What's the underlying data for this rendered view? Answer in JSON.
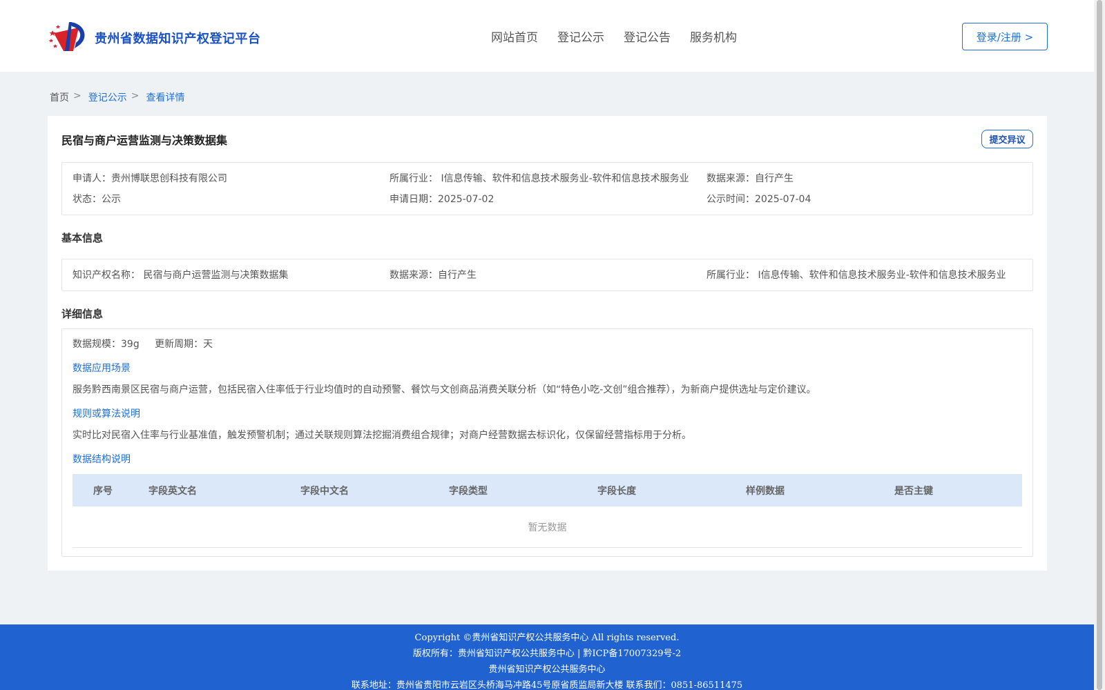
{
  "header": {
    "site_title": "贵州省数据知识产权登记平台",
    "nav": [
      "网站首页",
      "登记公示",
      "登记公告",
      "服务机构"
    ],
    "login_label": "登录/注册 >"
  },
  "breadcrumb": {
    "home": "首页",
    "separator": ">",
    "list": "登记公示",
    "current": "查看详情"
  },
  "record": {
    "title": "民宿与商户运营监测与决策数据集",
    "objection_label": "提交异议",
    "summary": {
      "applicant": "申请人：贵州博联思创科技有限公司",
      "industry": "所属行业：  I信息传输、软件和信息技术服务业-软件和信息技术服务业",
      "source": "数据来源：自行产生",
      "status": "状态：公示",
      "apply_date": "申请日期：2025-07-02",
      "publish_time": "公示时间：2025-07-04"
    },
    "basic_title": "基本信息",
    "basic": {
      "ip_name": "知识产权名称：  民宿与商户运营监测与决策数据集",
      "source": "数据来源：自行产生",
      "industry": "所属行业：  I信息传输、软件和信息技术服务业-软件和信息技术服务业"
    },
    "detail_title": "详细信息",
    "detail": {
      "scale": "数据规模：39g",
      "update_cycle": "更新周期：天",
      "scenario_title": "数据应用场景",
      "scenario_text": "服务黔西南景区民宿与商户运营，包括民宿入住率低于行业均值时的自动预警、餐饮与文创商品消费关联分析（如“特色小吃-文创”组合推荐），为新商户提供选址与定价建议。",
      "algorithm_title": "规则或算法说明",
      "algorithm_text": "实时比对民宿入住率与行业基准值，触发预警机制；通过关联规则算法挖掘消费组合规律；对商户经营数据去标识化，仅保留经营指标用于分析。",
      "structure_title": "数据结构说明",
      "table_headers": [
        "序号",
        "字段英文名",
        "字段中文名",
        "字段类型",
        "字段长度",
        "样例数据",
        "是否主键"
      ],
      "empty_text": "暂无数据"
    }
  },
  "footer": {
    "copyright": "Copyright ©贵州省知识产权公共服务中心 All rights reserved.",
    "rights": "版权所有：贵州省知识产权公共服务中心 | 黔ICP备17007329号-2",
    "org": "贵州省知识产权公共服务中心",
    "contact": "联系地址：贵州省贵阳市云岩区头桥海马冲路45号原省质监局新大楼 联系我们：0851-86511475"
  },
  "colors": {
    "brand_blue": "#1f6fd6",
    "footer_blue": "#1f62d0",
    "table_header": "#dbe8fa",
    "logo_red": "#d8232a"
  }
}
